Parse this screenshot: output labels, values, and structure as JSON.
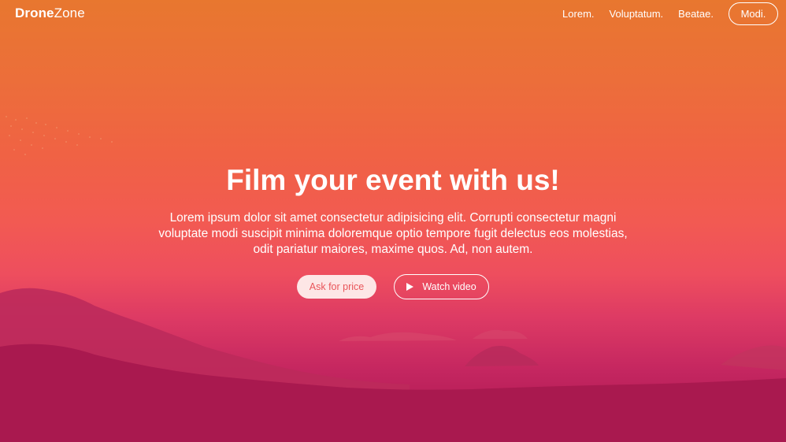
{
  "brand": {
    "bold": "Drone",
    "regular": "Zone"
  },
  "nav": {
    "links": [
      "Lorem.",
      "Voluptatum.",
      "Beatae."
    ],
    "cta": "Modi."
  },
  "hero": {
    "title": "Film your event with us!",
    "description": "Lorem ipsum dolor sit amet consectetur adipisicing elit. Corrupti consectetur magni voluptate modi suscipit minima doloremque optio tempore fugit delectus eos molestias, odit pariatur maiores, maxime quos. Ad, non autem.",
    "primary_button": "Ask for price",
    "secondary_button": "Watch video"
  },
  "icons": {
    "play": "play-icon"
  },
  "colors": {
    "top": "#e8772f",
    "middle": "#f25a52",
    "bottom": "#a8154f",
    "primary_button_bg": "#fde6e6",
    "primary_button_text": "#e9555a"
  }
}
